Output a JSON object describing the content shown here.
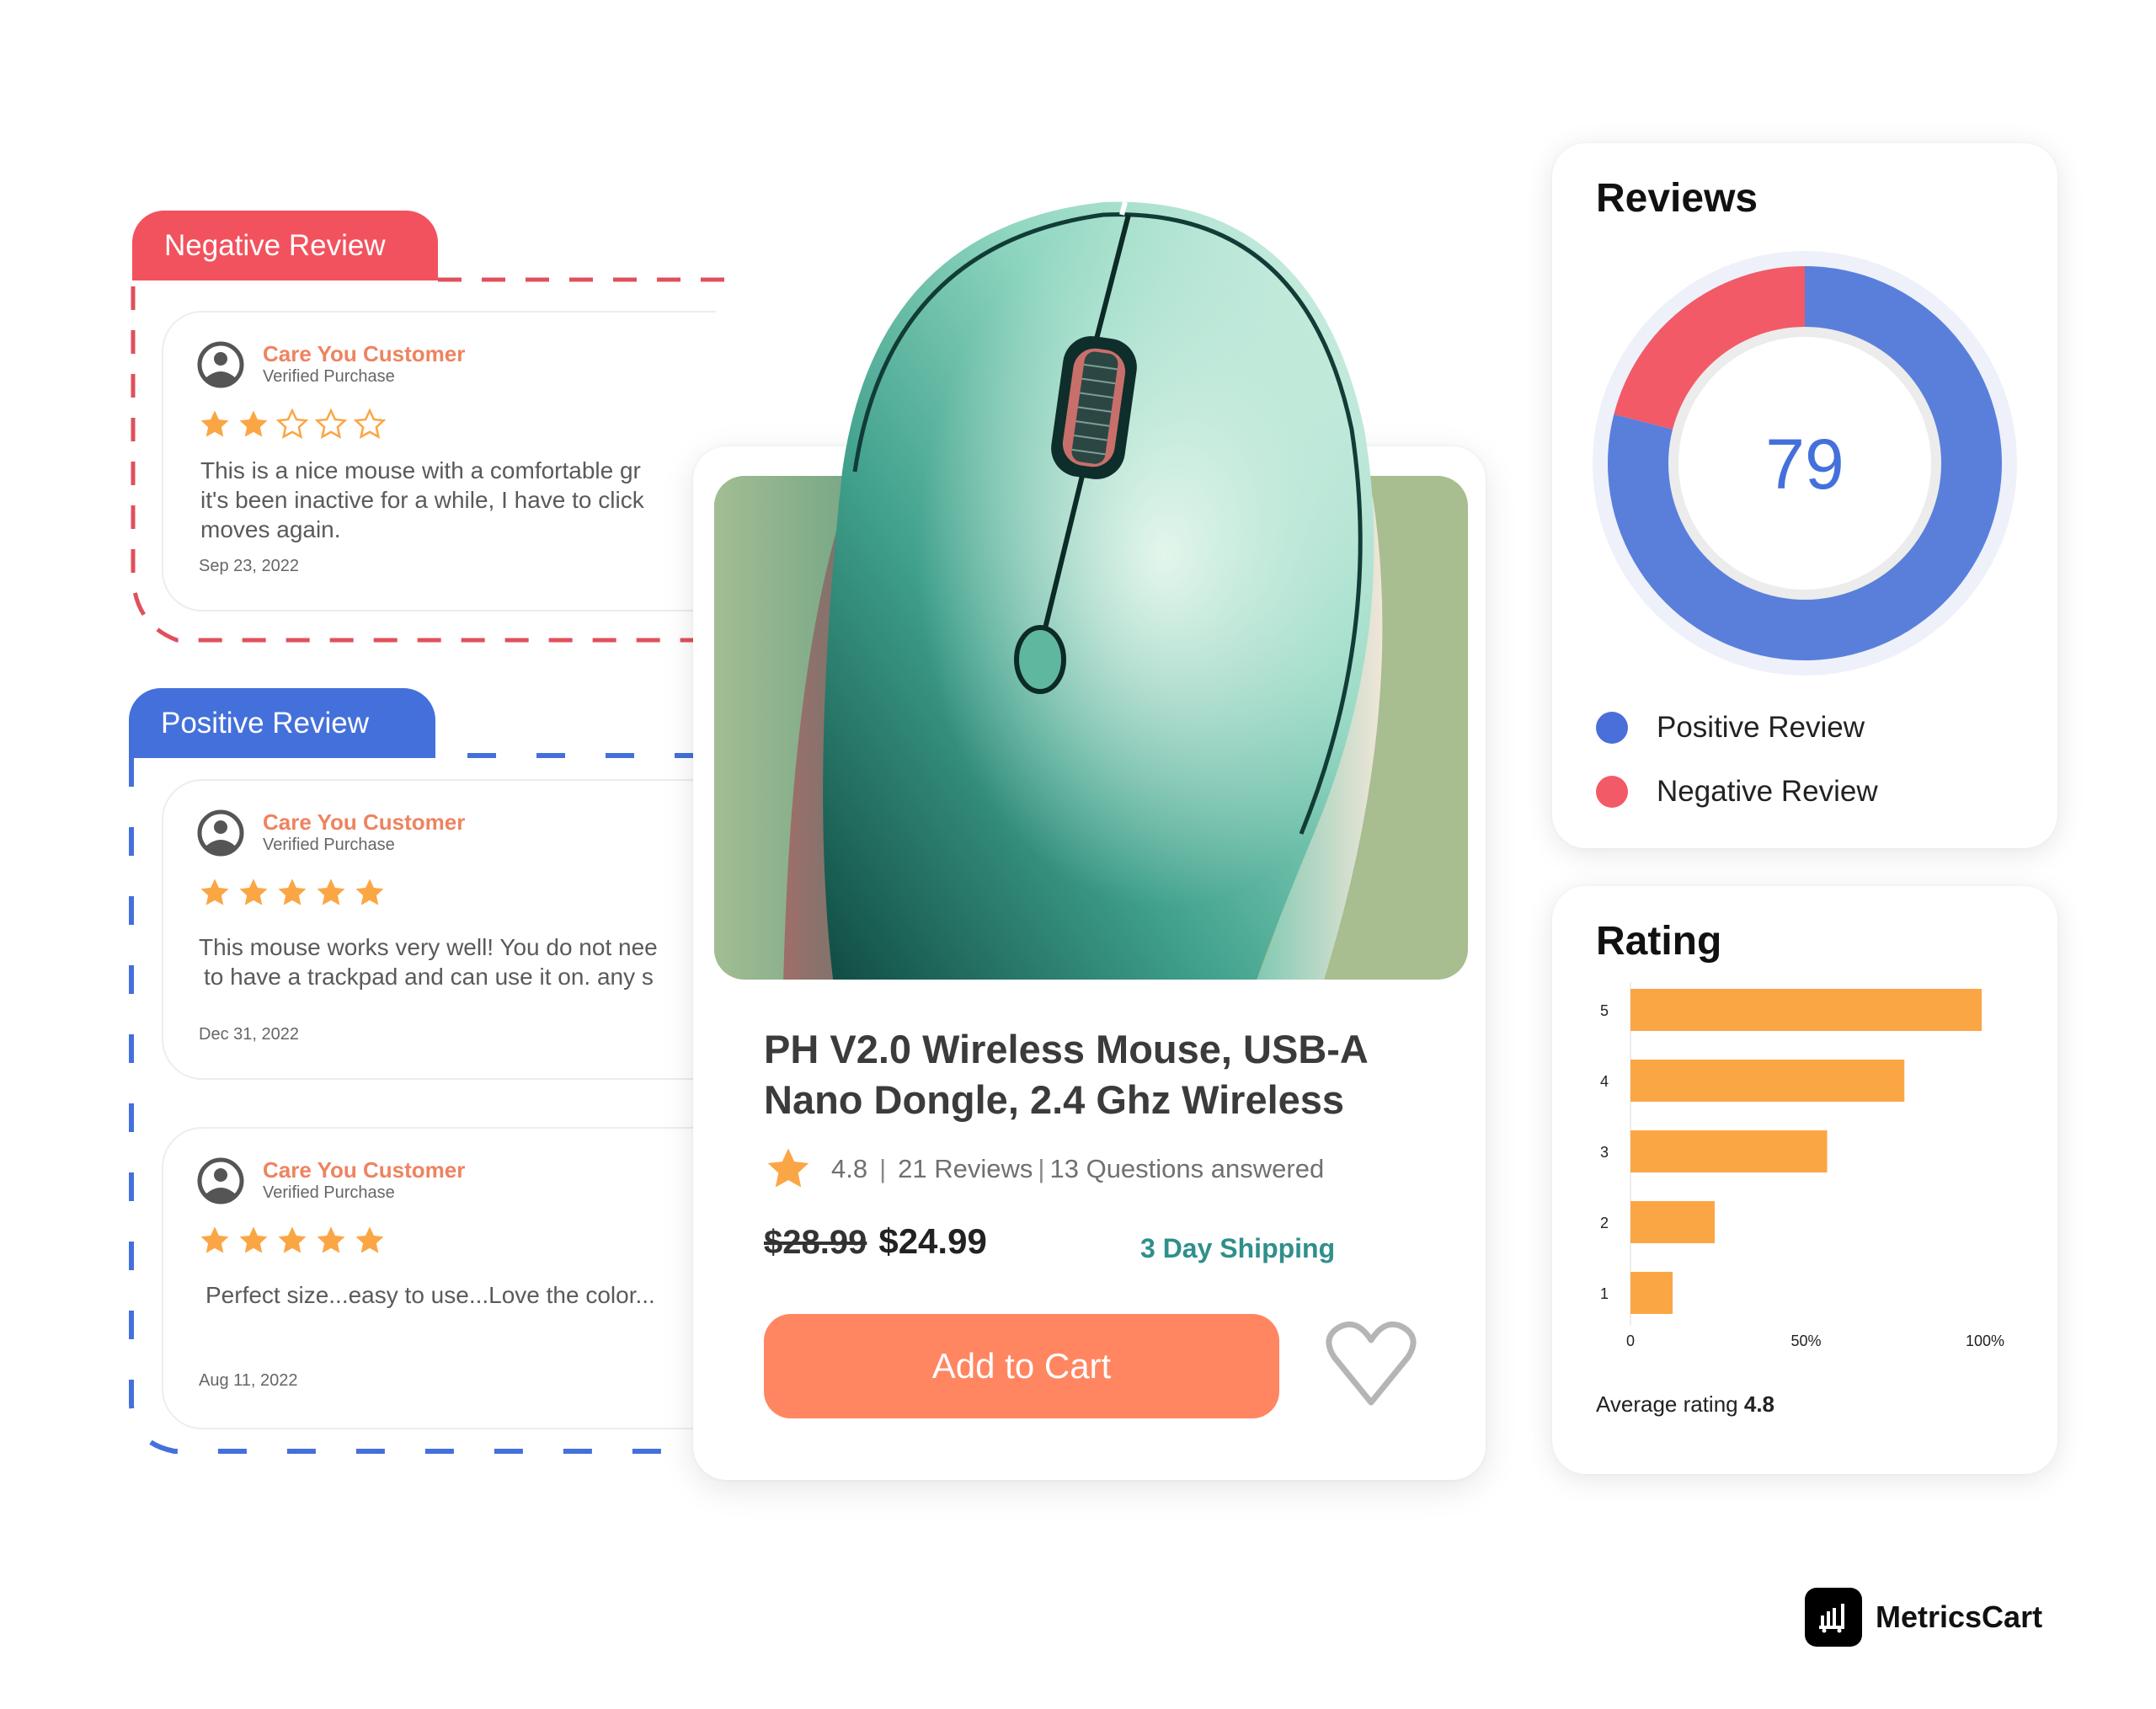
{
  "negative_group": {
    "tab_label": "Negative Review",
    "color": "#F2525E",
    "reviews": [
      {
        "customer": "Care You Customer",
        "verified": "Verified Purchase",
        "stars": 2,
        "line1": "This is a nice mouse with a comfortable gr",
        "line2": "it's been inactive for a while, I have to click",
        "line3": "moves again.",
        "date": "Sep 23, 2022"
      }
    ]
  },
  "positive_group": {
    "tab_label": "Positive Review",
    "color": "#4470DB",
    "reviews": [
      {
        "customer": "Care You Customer",
        "verified": "Verified Purchase",
        "stars": 5,
        "line1": "This mouse works very well! You do not nee",
        "line2": "to have a trackpad and can use it on. any s",
        "date": "Dec 31, 2022"
      },
      {
        "customer": "Care You Customer",
        "verified": "Verified Purchase",
        "stars": 5,
        "line1": "Perfect size...easy to use...Love the color...",
        "date": "Aug 11, 2022"
      }
    ]
  },
  "product": {
    "title": "PH V2.0 Wireless Mouse, USB-A Nano Dongle, 2.4 Ghz Wireless",
    "rating": "4.8",
    "reviews_count": "21 Reviews",
    "questions": "13 Questions answered",
    "old_price": "$28.99",
    "new_price": "$24.99",
    "shipping": "3 Day Shipping",
    "add_to_cart": "Add to Cart",
    "accent_color": "#FF8661",
    "image_bg_color": "#A8BD90"
  },
  "reviews_card": {
    "title": "Reviews",
    "center_value": "79",
    "legend": [
      {
        "label": "Positive Review",
        "color": "#5A7FDB"
      },
      {
        "label": "Negative Review",
        "color": "#F25A67"
      }
    ]
  },
  "rating_card": {
    "title": "Rating",
    "average_label": "Average  rating",
    "average_value": "4.8"
  },
  "chart_data": [
    {
      "type": "pie",
      "title": "Reviews",
      "donut": true,
      "center_label": "79",
      "categories": [
        "Positive Review",
        "Negative Review"
      ],
      "values": [
        79,
        21
      ],
      "colors": [
        "#5A7FDB",
        "#F25A67"
      ],
      "legend": "bottom-left"
    },
    {
      "type": "bar",
      "orientation": "horizontal",
      "title": "Rating",
      "categories": [
        "5",
        "4",
        "3",
        "2",
        "1"
      ],
      "values": [
        100,
        78,
        56,
        24,
        12
      ],
      "xlabel": "",
      "ylabel": "",
      "xlim": [
        0,
        100
      ],
      "xticks": [
        "0",
        "50%",
        "100%"
      ],
      "color": "#FBA645",
      "grid": false
    }
  ],
  "brand": {
    "name": "MetricsCart"
  }
}
